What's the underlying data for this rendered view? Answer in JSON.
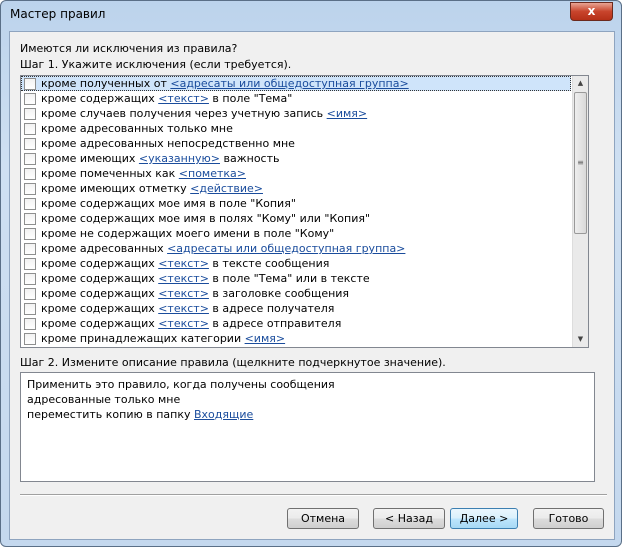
{
  "window": {
    "title": "Мастер правил",
    "close_label": "x"
  },
  "question": "Имеются ли исключения из правила?",
  "step1_label": "Шаг 1. Укажите исключения (если требуется).",
  "conditions": [
    {
      "text": "кроме полученных от ",
      "link": "<адресаты или общедоступная группа>",
      "after": "",
      "selected": true
    },
    {
      "text": "кроме содержащих ",
      "link": "<текст>",
      "after": " в поле \"Тема\""
    },
    {
      "text": "кроме случаев получения через учетную запись ",
      "link": "<имя>",
      "after": ""
    },
    {
      "text": "кроме адресованных только мне",
      "link": "",
      "after": ""
    },
    {
      "text": "кроме адресованных непосредственно мне",
      "link": "",
      "after": ""
    },
    {
      "text": "кроме имеющих ",
      "link": "<указанную>",
      "after": " важность"
    },
    {
      "text": "кроме помеченных как ",
      "link": "<пометка>",
      "after": ""
    },
    {
      "text": "кроме имеющих отметку ",
      "link": "<действие>",
      "after": ""
    },
    {
      "text": "кроме содержащих мое имя в поле \"Копия\"",
      "link": "",
      "after": ""
    },
    {
      "text": "кроме содержащих мое имя в полях \"Кому\" или \"Копия\"",
      "link": "",
      "after": ""
    },
    {
      "text": "кроме не содержащих моего имени в поле \"Кому\"",
      "link": "",
      "after": ""
    },
    {
      "text": "кроме адресованных ",
      "link": "<адресаты или общедоступная группа>",
      "after": ""
    },
    {
      "text": "кроме содержащих ",
      "link": "<текст>",
      "after": " в тексте сообщения"
    },
    {
      "text": "кроме содержащих ",
      "link": "<текст>",
      "after": " в поле \"Тема\" или в тексте"
    },
    {
      "text": "кроме содержащих ",
      "link": "<текст>",
      "after": " в заголовке сообщения"
    },
    {
      "text": "кроме содержащих ",
      "link": "<текст>",
      "after": " в адресе получателя"
    },
    {
      "text": "кроме содержащих ",
      "link": "<текст>",
      "after": " в адресе отправителя"
    },
    {
      "text": "кроме принадлежащих категории ",
      "link": "<имя>",
      "after": ""
    }
  ],
  "step2_label": "Шаг 2. Измените описание правила (щелкните подчеркнутое значение).",
  "description": {
    "line1": "Применить это правило, когда получены сообщения",
    "line2": "адресованные только мне",
    "line3_text": "переместить копию в папку ",
    "line3_link": "Входящие"
  },
  "buttons": {
    "cancel": "Отмена",
    "back": "< Назад",
    "next": "Далее >",
    "finish": "Готово"
  }
}
